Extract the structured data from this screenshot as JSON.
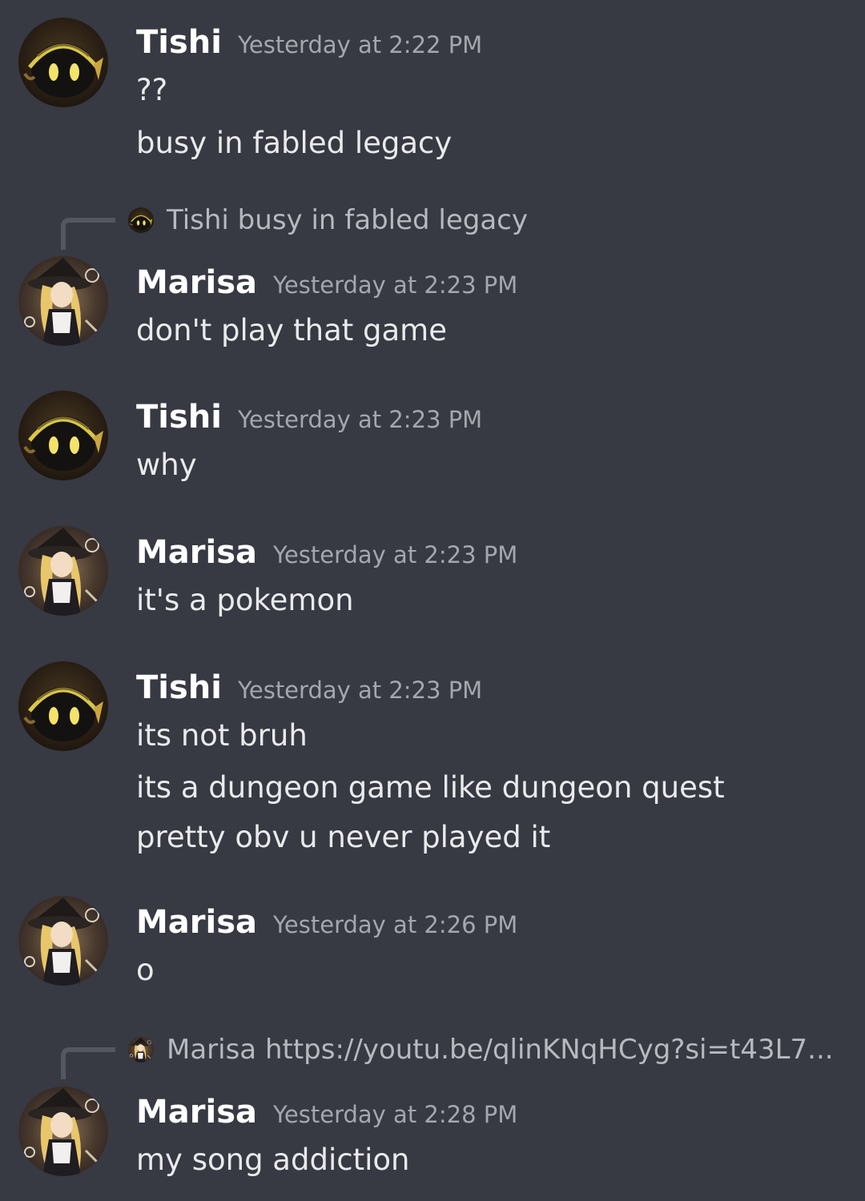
{
  "colors": {
    "background": "#373943",
    "username": "#ffffff",
    "timestamp": "#a4a7ad",
    "message_text": "#e9eaec",
    "reply_text": "#b6b9be"
  },
  "messages": [
    {
      "author": "Tishi",
      "avatar_icon": "tishi-avatar-icon",
      "timestamp": "Yesterday at 2:22 PM",
      "lines": [
        "??",
        "busy in fabled legacy"
      ]
    },
    {
      "author": "Marisa",
      "avatar_icon": "marisa-avatar-icon",
      "timestamp": "Yesterday at 2:23 PM",
      "reply": "Tishi busy in fabled legacy",
      "lines": [
        "don't play that game"
      ]
    },
    {
      "author": "Tishi",
      "avatar_icon": "tishi-avatar-icon",
      "timestamp": "Yesterday at 2:23 PM",
      "lines": [
        "why"
      ]
    },
    {
      "author": "Marisa",
      "avatar_icon": "marisa-avatar-icon",
      "timestamp": "Yesterday at 2:23 PM",
      "lines": [
        "it's a pokemon"
      ]
    },
    {
      "author": "Tishi",
      "avatar_icon": "tishi-avatar-icon",
      "timestamp": "Yesterday at 2:23 PM",
      "lines": [
        "its not bruh",
        "its a dungeon game like dungeon quest",
        "pretty obv u never played it"
      ]
    },
    {
      "author": "Marisa",
      "avatar_icon": "marisa-avatar-icon",
      "timestamp": "Yesterday at 2:26 PM",
      "lines": [
        "o"
      ]
    },
    {
      "author": "Marisa",
      "avatar_icon": "marisa-avatar-icon",
      "timestamp": "Yesterday at 2:28 PM",
      "reply": "Marisa https://youtu.be/qlinKNqHCyg?si=t43L7...",
      "lines": [
        "my song addiction"
      ]
    }
  ]
}
